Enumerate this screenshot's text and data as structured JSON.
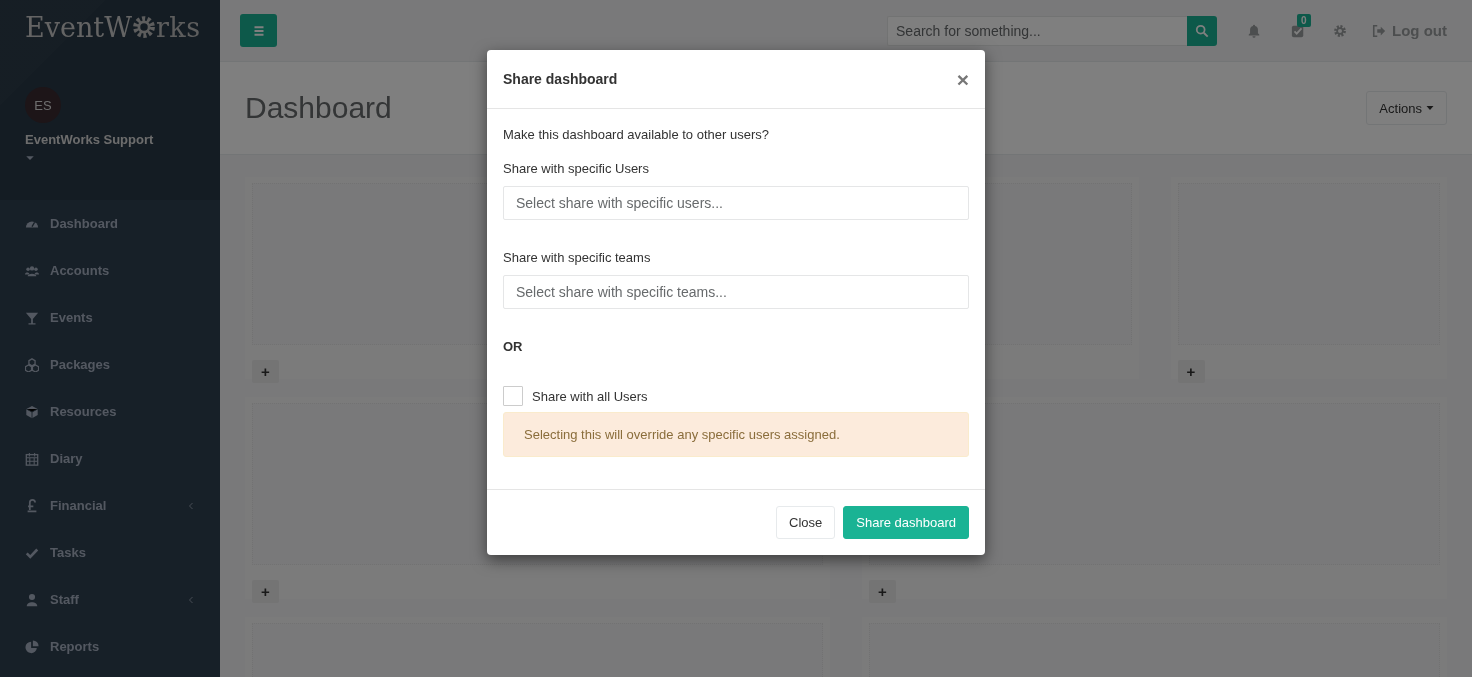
{
  "sidebar": {
    "logo": {
      "before": "EventW",
      "after": "rks"
    },
    "profile": {
      "initials": "ES",
      "name": "EventWorks Support"
    },
    "items": [
      {
        "label": "Dashboard",
        "submenu": false
      },
      {
        "label": "Accounts",
        "submenu": false
      },
      {
        "label": "Events",
        "submenu": false
      },
      {
        "label": "Packages",
        "submenu": false
      },
      {
        "label": "Resources",
        "submenu": false
      },
      {
        "label": "Diary",
        "submenu": false
      },
      {
        "label": "Financial",
        "submenu": true
      },
      {
        "label": "Tasks",
        "submenu": false
      },
      {
        "label": "Staff",
        "submenu": true
      },
      {
        "label": "Reports",
        "submenu": false
      }
    ]
  },
  "topbar": {
    "search": {
      "placeholder": "Search for something..."
    },
    "tasks_badge": "0",
    "logout": "Log out"
  },
  "page": {
    "title": "Dashboard",
    "actions": "Actions"
  },
  "widget_rows": [
    [
      {
        "add": "+"
      },
      null,
      {},
      {
        "add": "+"
      }
    ],
    [
      {
        "add": "+"
      },
      {
        "add": "+"
      }
    ],
    [
      {},
      {}
    ]
  ],
  "modal": {
    "title": "Share dashboard",
    "close": "×",
    "intro": "Make this dashboard available to other users?",
    "fields": [
      {
        "label": "Share with specific Users",
        "placeholder": "Select share with specific users..."
      },
      {
        "label": "Share with specific teams",
        "placeholder": "Select share with specific teams..."
      }
    ],
    "or": "OR",
    "share_all": {
      "label": "Share with all Users",
      "checked": false
    },
    "warning": "Selecting this will override any specific users assigned.",
    "buttons": [
      {
        "label": "Close",
        "kind": "default"
      },
      {
        "label": "Share dashboard",
        "kind": "primary"
      }
    ]
  }
}
